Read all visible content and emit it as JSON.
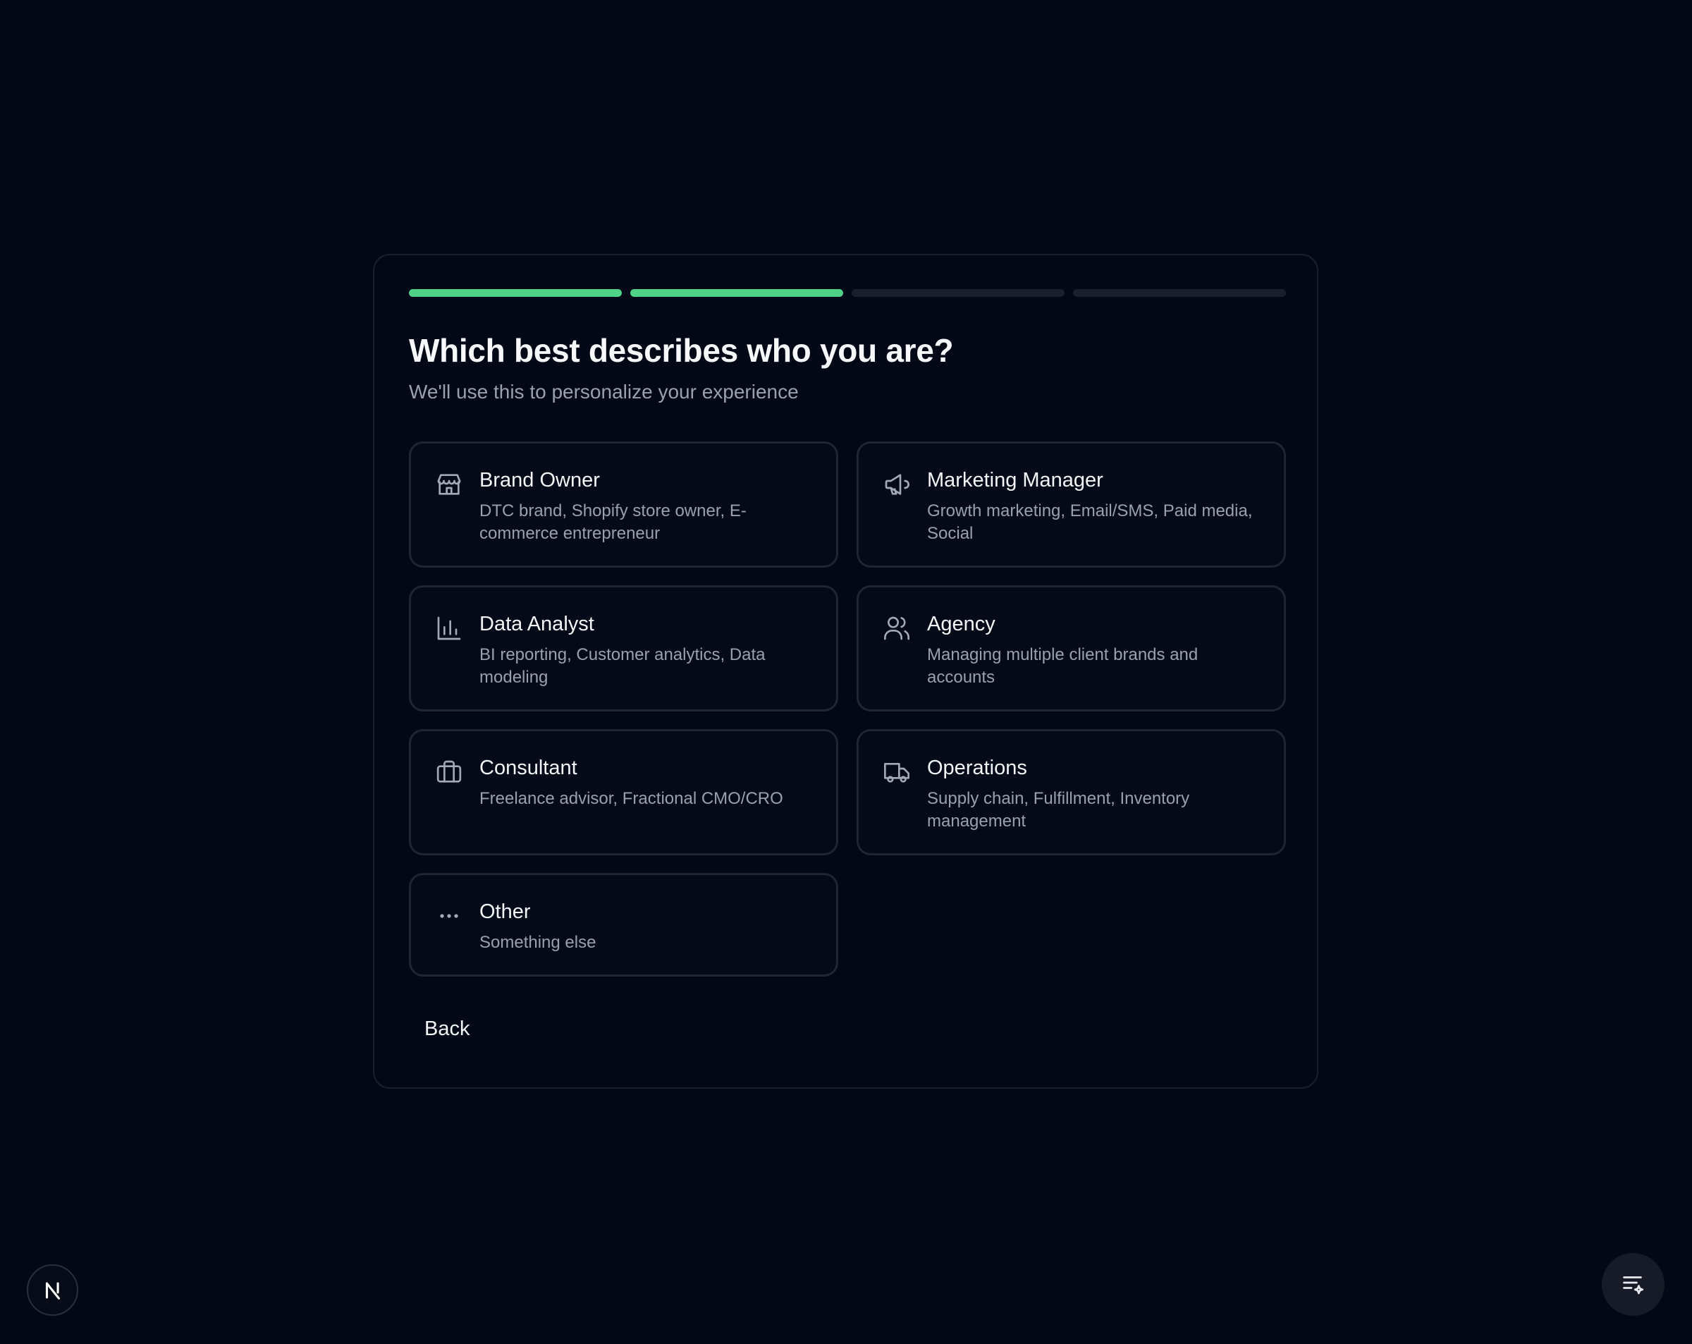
{
  "onboarding": {
    "progress": {
      "total_steps": 4,
      "completed_steps": 2,
      "active_color": "#4ed287",
      "inactive_color": "#1a1f2c"
    },
    "title": "Which best describes who you are?",
    "subtitle": "We'll use this to personalize your experience",
    "options": [
      {
        "label": "Brand Owner",
        "description": "DTC brand, Shopify store owner, E-commerce entrepreneur",
        "icon": "store-icon"
      },
      {
        "label": "Marketing Manager",
        "description": "Growth marketing, Email/SMS, Paid media, Social",
        "icon": "megaphone-icon"
      },
      {
        "label": "Data Analyst",
        "description": "BI reporting, Customer analytics, Data modeling",
        "icon": "bar-chart-icon"
      },
      {
        "label": "Agency",
        "description": "Managing multiple client brands and accounts",
        "icon": "users-icon"
      },
      {
        "label": "Consultant",
        "description": "Freelance advisor, Fractional CMO/CRO",
        "icon": "briefcase-icon"
      },
      {
        "label": "Operations",
        "description": "Supply chain, Fulfillment, Inventory management",
        "icon": "truck-icon"
      },
      {
        "label": "Other",
        "description": "Something else",
        "icon": "more-horizontal-icon"
      }
    ],
    "back_label": "Back"
  },
  "corner": {
    "left_badge_icon": "nextjs-logo-icon",
    "right_button_icon": "list-sparkle-icon"
  }
}
